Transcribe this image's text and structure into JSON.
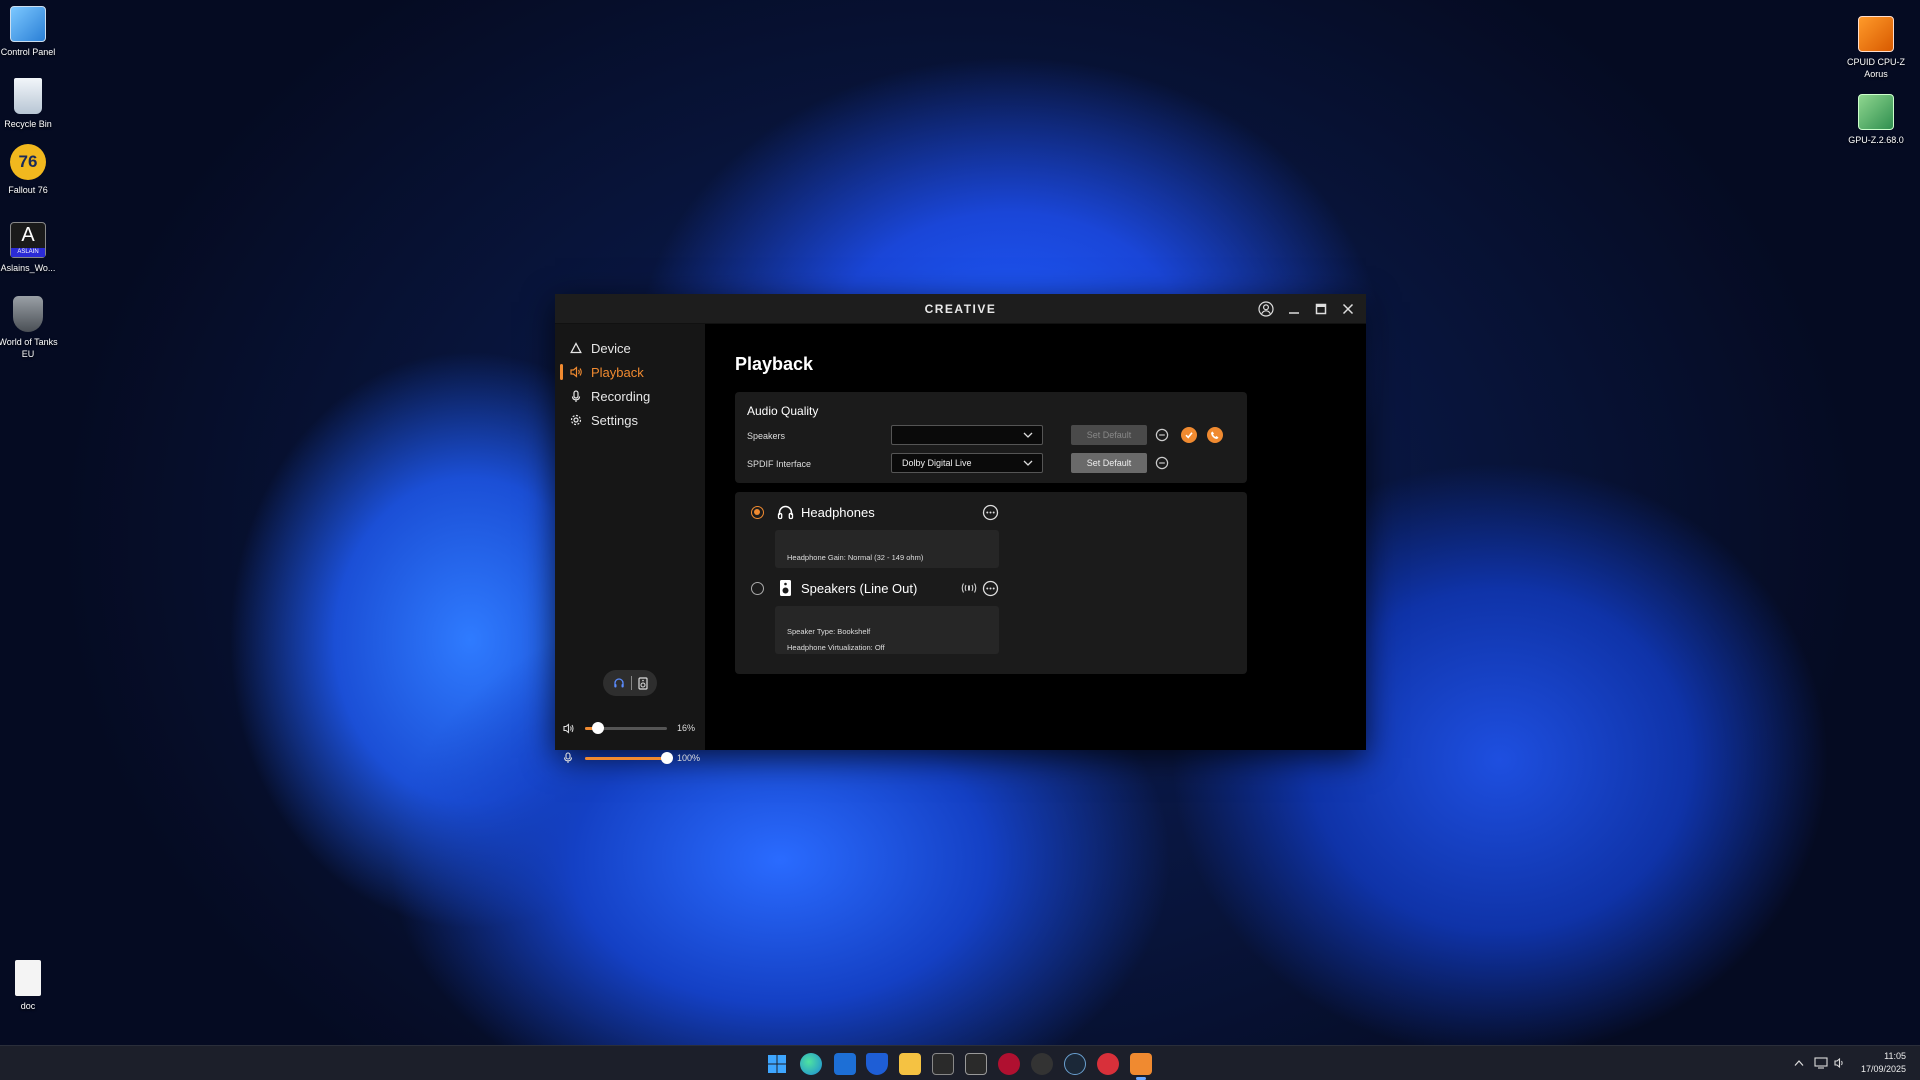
{
  "desktop": {
    "icons_left": [
      {
        "label": "Control Panel"
      },
      {
        "label": "Recycle Bin"
      },
      {
        "label": "Fallout 76"
      },
      {
        "label": "Aslains_Wo..."
      },
      {
        "label": "World of Tanks EU"
      },
      {
        "label": "doc"
      }
    ],
    "icons_right": [
      {
        "label": "CPUID CPU-Z Aorus"
      },
      {
        "label": "GPU-Z.2.68.0"
      }
    ],
    "fallout_badge": "76",
    "aslain_badge": "ASLAIN",
    "aslain_letter": "A"
  },
  "app": {
    "brand": "CREATIVE",
    "nav": [
      {
        "label": "Device",
        "icon": "device-icon"
      },
      {
        "label": "Playback",
        "icon": "speaker-icon",
        "active": true
      },
      {
        "label": "Recording",
        "icon": "microphone-icon"
      },
      {
        "label": "Settings",
        "icon": "gear-icon"
      }
    ],
    "volume": {
      "value_label": "16%",
      "level": 0.16
    },
    "mic": {
      "value_label": "100%",
      "level": 1.0
    },
    "page_title": "Playback",
    "audio_quality": {
      "title": "Audio Quality",
      "rows": [
        {
          "label": "Speakers",
          "value": "",
          "button": "Set Default",
          "enabled": false
        },
        {
          "label": "SPDIF Interface",
          "value": "Dolby Digital Live",
          "button": "Set Default",
          "enabled": true
        }
      ]
    },
    "devices": [
      {
        "name": "Headphones",
        "selected": true,
        "details": [
          "Headphone Gain: Normal (32 - 149 ohm)"
        ]
      },
      {
        "name": "Speakers (Line Out)",
        "selected": false,
        "details": [
          "Speaker Type: Bookshelf",
          "Headphone Virtualization: Off"
        ]
      }
    ]
  },
  "taskbar": {
    "time": "11:05",
    "date": "17/09/2025"
  },
  "colors": {
    "accent": "#f08a30",
    "window_bg": "#000000",
    "sidebar_bg": "#161616"
  }
}
